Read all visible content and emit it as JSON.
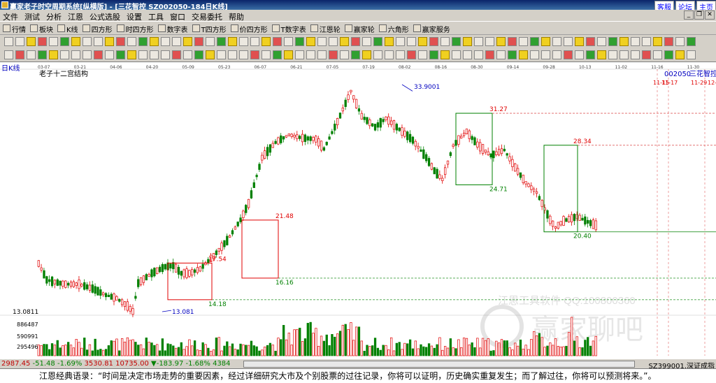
{
  "window": {
    "title": "赢家老子时空周期系统[纵横版] - [三花智控   SZ002050-184日K线]",
    "links": [
      "客服",
      "论坛",
      "主页"
    ]
  },
  "menu": [
    "文件",
    "测试",
    "分析",
    "江恩",
    "公式选股",
    "设置",
    "工具",
    "窗口",
    "交易委托",
    "帮助"
  ],
  "toolbar1": [
    "行情",
    "板块",
    "K线",
    "四方形",
    "时四方形",
    "数字表",
    "T四方形",
    "价四方形",
    "T数字表",
    "江恩轮",
    "赢家轮",
    "六角形",
    "赢家服务"
  ],
  "chart": {
    "period_label": "日K线",
    "indicator_label": "老子十二宫结构",
    "code": "002050",
    "name": "三花智控",
    "right_labels": [
      "11-15",
      "11-17",
      "11-29",
      "12-"
    ],
    "date_ticks": [
      "03-07",
      "03-21",
      "04-06",
      "04-20",
      "05-09",
      "05-23",
      "06-07",
      "06-21",
      "07-05",
      "07-19",
      "08-02",
      "08-16",
      "08-30",
      "09-14",
      "09-28",
      "10-13",
      "11-02",
      "11-16",
      "11-30"
    ],
    "price_labels": [
      "33.9001",
      "31.27",
      "28.34",
      "24.71",
      "21.48",
      "20.40",
      "17.54",
      "16.16",
      "14.18",
      "13.081",
      "13.0811"
    ],
    "volume_labels": [
      "886487",
      "590991",
      "295496"
    ],
    "watermark": "江恩工具软件  QQ:100800360",
    "watermark2": "赢家聊吧",
    "colors": {
      "up": "#e00000",
      "down": "#008000",
      "box": "#e00000",
      "box2": "#008000"
    }
  },
  "status": {
    "sh": "2987.45",
    "sh_chg": "-51.48",
    "sh_pct": "-1.69%",
    "sh_vol": "3530.81",
    "sz": "10735.00",
    "sz_chg": "▼-183.97",
    "sz_pct": "-1.68%",
    "sz_vol": "4384",
    "right": "SZ399001,深证成指"
  },
  "quote": "江恩经典语录：“时间是决定市场走势的重要因素，经过详细研究大市及个别股票的过往记录，你将可以证明，历史确实重复发生；而了解过往，你将可以预测将来。”。"
}
